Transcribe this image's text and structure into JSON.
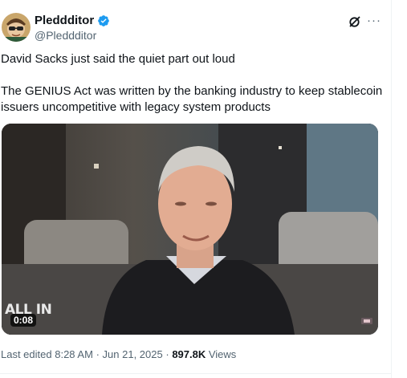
{
  "author": {
    "display_name": "Pleddditor",
    "handle": "@Pleddditor",
    "verified": true
  },
  "tweet": {
    "line1": "David Sacks just said the quiet part out loud",
    "line2": "The GENIUS Act was written by the banking industry to keep stablecoin issuers uncompetitive with legacy system products"
  },
  "video": {
    "duration": "0:08",
    "watermark": "ALL IN"
  },
  "meta": {
    "edited_label": "Last edited",
    "time": "8:28 AM",
    "separator1": "·",
    "date": "Jun 21, 2025",
    "separator2": "·",
    "views_count": "897.8K",
    "views_label": "Views"
  },
  "colors": {
    "verified_badge": "#1d9bf0",
    "secondary_text": "#536471",
    "primary_text": "#0f1419"
  }
}
